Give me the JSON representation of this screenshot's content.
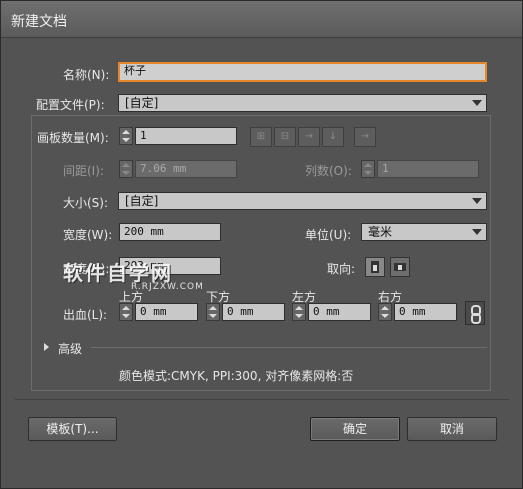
{
  "window": {
    "title": "新建文档"
  },
  "name": {
    "label": "名称(N):",
    "value": "杯子"
  },
  "profile": {
    "label": "配置文件(P):",
    "value": "[自定]"
  },
  "artboards": {
    "count_label": "画板数量(M):",
    "count_value": "1",
    "spacing_label": "间距(I):",
    "spacing_value": "7.06 mm",
    "columns_label": "列数(O):",
    "columns_value": "1"
  },
  "size": {
    "label": "大小(S):",
    "value": "[自定]"
  },
  "width": {
    "label": "宽度(W):",
    "value": "200 mm"
  },
  "height": {
    "label": "高度(H):",
    "value": "203 mm"
  },
  "units": {
    "label": "单位(U):",
    "value": "毫米"
  },
  "orientation": {
    "label": "取向:"
  },
  "bleed": {
    "label": "出血(L):",
    "top_label": "上方",
    "bottom_label": "下方",
    "left_label": "左方",
    "right_label": "右方",
    "top_value": "0 mm",
    "bottom_value": "0 mm",
    "left_value": "0 mm",
    "right_value": "0 mm"
  },
  "advanced": {
    "label": "高级"
  },
  "summary": "颜色模式:CMYK, PPI:300, 对齐像素网格:否",
  "buttons": {
    "templates": "模板(T)...",
    "ok": "确定",
    "cancel": "取消"
  },
  "watermark": {
    "main": "软件自学网",
    "sub": "R.RJZXW.COM"
  }
}
